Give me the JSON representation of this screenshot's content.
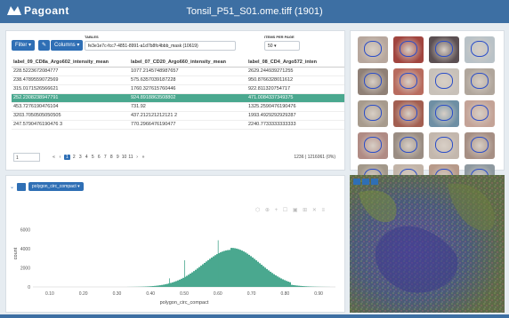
{
  "app": {
    "logo_text": "Pagoant",
    "title": "Tonsil_P51_S01.ome.tiff (1901)"
  },
  "table_panel": {
    "filter_button": "Filter",
    "settings_icon": "wrench-icon",
    "columns_button": "Columns",
    "tables_label": "TABLES",
    "tables_value": "fe3e1e7c-fcc7-4851-8991-a1d7b8fc4bbb_mask (10619)",
    "ipp_label": "ITEMS PER PAGE",
    "ipp_value": "50",
    "columns": [
      "label_09_CD8a_Argo602_intensity_mean",
      "label_07_CD20_Argo660_intensity_mean",
      "label_08_CD4_Argo572_inten"
    ],
    "rows": [
      [
        "228.5223672084777",
        "1077.2145748987657",
        "2629.244939271255"
      ],
      [
        "238.4789559072569",
        "575.6357039187228",
        "950.8766328011612"
      ],
      [
        "315.0171526566621",
        "1760.327615760446",
        "922.811320754717"
      ],
      [
        "252.2308238947791",
        "924.8918863508802",
        "471.0084337349375"
      ],
      [
        "453.7276190476104",
        "731.92",
        "1325.2590476190476"
      ],
      [
        "3203.7050505050505",
        "437.212121212121 2",
        "1993.4929292929287"
      ],
      [
        "247.5790476190476 3",
        "770.2966476190477",
        "2240.7733333333333"
      ]
    ],
    "selected_row": 3,
    "pager": {
      "page_value": "1",
      "pages": [
        "«",
        "‹",
        "1",
        "2",
        "3",
        "4",
        "5",
        "6",
        "7",
        "8",
        "9",
        "10",
        "11",
        "›",
        "»"
      ],
      "active_page": "1",
      "count_text": "1236 | 1216061 (0%)"
    }
  },
  "chart_panel": {
    "toggle_icon": "chevron-down-icon",
    "feature_select": "polygon_circ_compact",
    "tools_text": "⬡ ⊕ + ☐ ▣ ⊞ ✕ ≡"
  },
  "chart_data": {
    "type": "bar",
    "title": "",
    "xlabel": "polygon_circ_compact",
    "ylabel": "count",
    "xlim": [
      0.05,
      0.95
    ],
    "ylim": [
      0,
      7000
    ],
    "xticks": [
      "0.10",
      "0.20",
      "0.30",
      "0.40",
      "0.50",
      "0.60",
      "0.70",
      "0.80",
      "0.90"
    ],
    "yticks": [
      "0",
      "2000",
      "4000",
      "6000"
    ],
    "color": "#4aa88f",
    "peak_x": 0.64,
    "peak_y": 4100,
    "spread": 0.085
  },
  "image_viewer": {
    "tool_icons": [
      "pointer-icon",
      "expand-icon",
      "layers-icon"
    ]
  },
  "thumbnails": {
    "count": 20,
    "colors": [
      "#b7a79d",
      "#a1453f",
      "#5b4f52",
      "#b9c2c7",
      "#8f8076",
      "#b86c5f",
      "#c8c1b9",
      "#b0a69c",
      "#a79b8d",
      "#a35f51",
      "#6e8fa4",
      "#c4a397",
      "#b08b84",
      "#9a8d83",
      "#c3b7ad",
      "#a68f84",
      "#a2988a",
      "#c2b4a8",
      "#b79a8a",
      "#8e99a0"
    ]
  }
}
